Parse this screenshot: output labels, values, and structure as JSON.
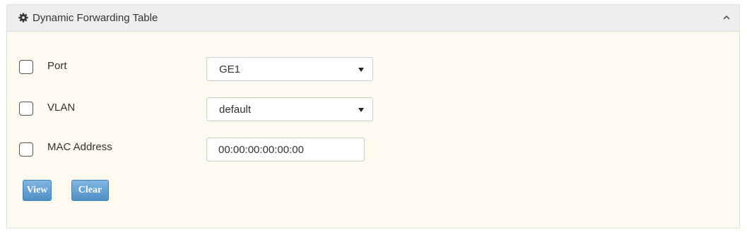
{
  "panel": {
    "title": "Dynamic Forwarding Table",
    "header_icon": "gear-icon",
    "toggle_icon": "chevron-up-icon"
  },
  "filters": {
    "port": {
      "label": "Port",
      "checked": false,
      "selected_value": "GE1"
    },
    "vlan": {
      "label": "VLAN",
      "checked": false,
      "selected_value": "default"
    },
    "mac": {
      "label": "MAC Address",
      "checked": false,
      "value": "00:00:00:00:00:00"
    }
  },
  "actions": {
    "view_label": "View",
    "clear_label": "Clear"
  },
  "colors": {
    "panel_background": "#fdfbf0",
    "header_background": "#eeeeee",
    "button_blue": "#5b9bd1"
  }
}
